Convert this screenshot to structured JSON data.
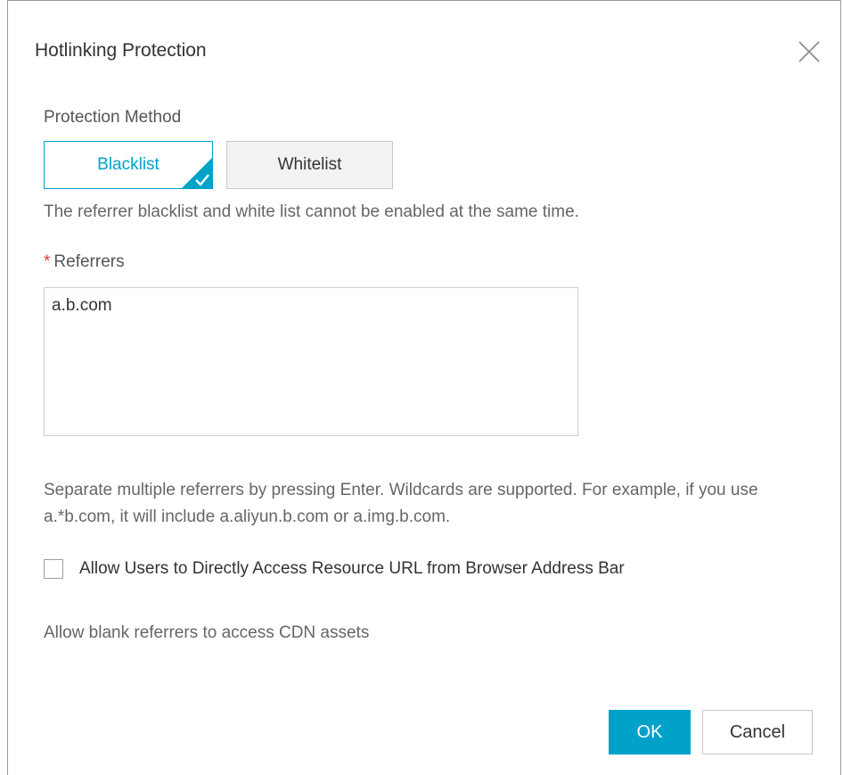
{
  "dialog": {
    "title": "Hotlinking Protection",
    "close_icon": "close-icon"
  },
  "protection_method": {
    "label": "Protection Method",
    "options": [
      "Blacklist",
      "Whitelist"
    ],
    "selected": "Blacklist",
    "hint": "The referrer blacklist and white list cannot be enabled at the same time."
  },
  "referrers": {
    "required_mark": "*",
    "label": "Referrers",
    "value": "a.b.com",
    "hint": "Separate multiple referrers by pressing Enter. Wildcards are supported. For example, if you use a.*b.com, it will include a.aliyun.b.com or a.img.b.com."
  },
  "allow_blank": {
    "checked": false,
    "label": "Allow Users to Directly Access Resource URL from Browser Address Bar",
    "hint": "Allow blank referrers to access CDN assets"
  },
  "footer": {
    "ok_label": "OK",
    "cancel_label": "Cancel"
  },
  "colors": {
    "accent": "#00a2ca",
    "required": "#e4393c"
  }
}
